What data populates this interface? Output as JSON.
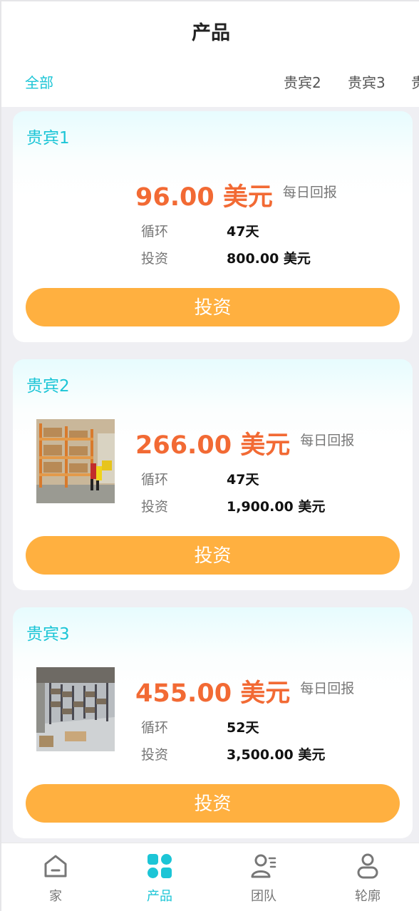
{
  "header": {
    "title": "产品"
  },
  "tabs": [
    {
      "label": "全部",
      "active": true
    },
    {
      "label": "贵宾2"
    },
    {
      "label": "贵宾3"
    },
    {
      "label": "贵"
    }
  ],
  "products": [
    {
      "name": "贵宾1",
      "price": "96.00 美元",
      "daily": "每日回报",
      "cycle_label": "循环",
      "cycle": "47天",
      "invest_label": "投资",
      "invest": "800.00 美元",
      "button": "投资",
      "has_image": false
    },
    {
      "name": "贵宾2",
      "price": "266.00 美元",
      "daily": "每日回报",
      "cycle_label": "循环",
      "cycle": "47天",
      "invest_label": "投资",
      "invest": "1,900.00 美元",
      "button": "投资",
      "has_image": true
    },
    {
      "name": "贵宾3",
      "price": "455.00 美元",
      "daily": "每日回报",
      "cycle_label": "循环",
      "cycle": "52天",
      "invest_label": "投资",
      "invest": "3,500.00 美元",
      "button": "投资",
      "has_image": true
    }
  ],
  "tabbar": [
    {
      "label": "家",
      "icon": "home-icon"
    },
    {
      "label": "产品",
      "icon": "products-icon",
      "active": true
    },
    {
      "label": "团队",
      "icon": "team-icon"
    },
    {
      "label": "轮廓",
      "icon": "profile-icon"
    }
  ],
  "colors": {
    "accent": "#1cc5d6",
    "price": "#f26a34",
    "button": "#ffb040"
  }
}
